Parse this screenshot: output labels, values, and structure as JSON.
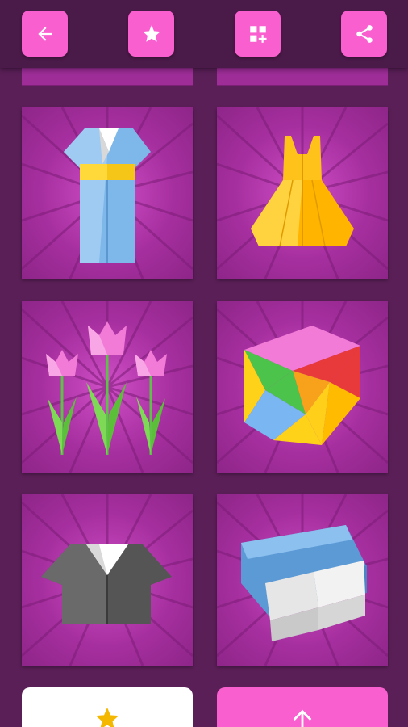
{
  "toolbar": {
    "back_icon": "arrow-left-icon",
    "favorite_icon": "star-icon",
    "more_apps_icon": "grid-plus-icon",
    "share_icon": "share-icon"
  },
  "tiles": [
    {
      "subject": "kimono-origami"
    },
    {
      "subject": "dress-origami"
    },
    {
      "subject": "tulips-origami"
    },
    {
      "subject": "cube-origami"
    },
    {
      "subject": "shirt-origami"
    },
    {
      "subject": "sofa-origami"
    }
  ],
  "bottom_bar": {
    "favorites_icon": "star-icon",
    "scroll_top_icon": "arrow-up-icon"
  },
  "colors": {
    "background": "#5a1f57",
    "toolbar": "#4a1a48",
    "accent_pink": "#f95fcf",
    "tile": "#a62f9f",
    "star": "#f5b800"
  }
}
